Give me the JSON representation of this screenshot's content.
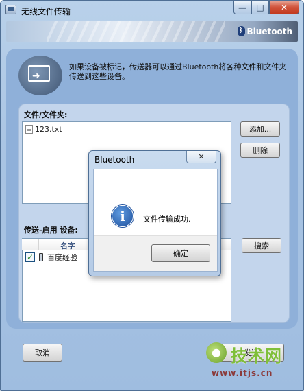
{
  "window": {
    "title": "无线文件传输",
    "brand": "Bluetooth",
    "brand_mark": "ᛒ",
    "caption_min": "—",
    "caption_max": "□",
    "caption_close": "✕"
  },
  "intro": {
    "text": "如果设备被标记，传送器可以通过Bluetooth将各种文件和文件夹传送到这些设备。"
  },
  "files_section": {
    "label": "文件/文件夹:",
    "files": [
      "123.txt"
    ],
    "add_button": "添加...",
    "delete_button": "删除"
  },
  "devices_section": {
    "label": "传送-启用 设备:",
    "column_name": "名字",
    "devices": [
      {
        "checked": true,
        "check_mark": "✓",
        "name": "百度经验"
      }
    ],
    "search_button": "搜索"
  },
  "footer": {
    "cancel_button": "取消",
    "send_button": "发送"
  },
  "dialog": {
    "title": "Bluetooth",
    "close_label": "✕",
    "icon_glyph": "i",
    "message": "文件传输成功.",
    "ok_button": "确定"
  },
  "watermark": {
    "brand": "技术网",
    "logo_char": "●",
    "url": "www.itjs.cn"
  },
  "colors": {
    "window_bg": "#a9c4e3",
    "panel_bg": "#c3d5ec",
    "close_btn": "#c23a1f",
    "info_icon": "#1d4f9c"
  }
}
